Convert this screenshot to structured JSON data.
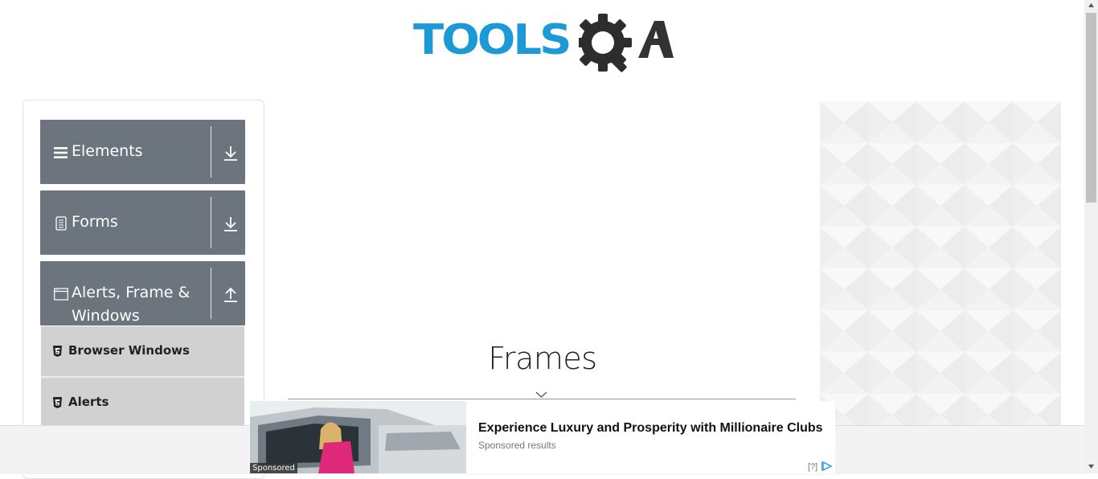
{
  "header": {
    "logo_text_blue": "TOOLS",
    "logo_text_dark": "QA"
  },
  "sidebar": {
    "groups": [
      {
        "label": "Elements",
        "icon": "hamburger-icon",
        "arrow": "download-arrow-icon"
      },
      {
        "label": "Forms",
        "icon": "document-icon",
        "arrow": "download-arrow-icon"
      },
      {
        "label": "Alerts, Frame & Windows",
        "icon": "window-icon",
        "arrow": "upload-arrow-icon"
      }
    ],
    "items": [
      {
        "label": "Browser Windows",
        "icon": "html5-icon"
      },
      {
        "label": "Alerts",
        "icon": "html5-icon"
      }
    ]
  },
  "main": {
    "title": "Frames"
  },
  "bottom_ad": {
    "sponsored_tag": "Sponsored",
    "headline": "Experience Luxury and Prosperity with Millionaire Clubs",
    "source": "Sponsored results",
    "help": "[?]"
  },
  "colors": {
    "logo_blue": "#1b9ad6",
    "logo_dark": "#333333",
    "group_bg": "#6c757d",
    "item_bg": "#d1d1d1"
  }
}
